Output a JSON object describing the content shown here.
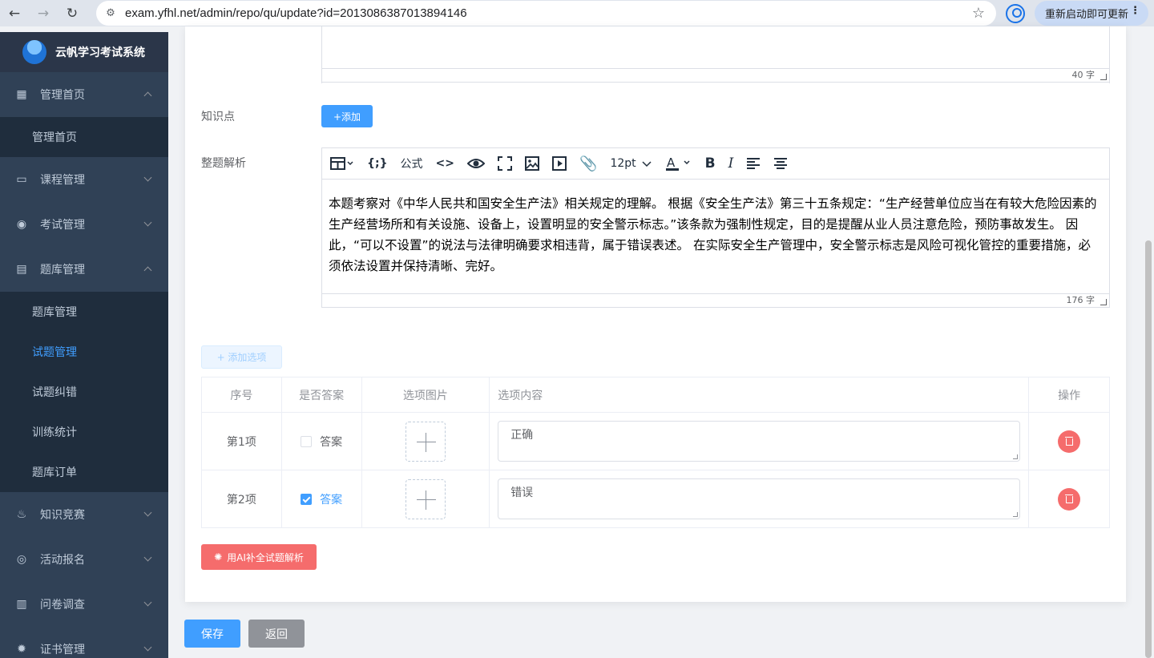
{
  "browser": {
    "url": "exam.yfhl.net/admin/repo/qu/update?id=2013086387013894146",
    "update_label": "重新启动即可更新"
  },
  "sidebar": {
    "logo_title": "云帆学习考试系统",
    "menu": [
      {
        "label": "管理首页",
        "icon": "dashboard-icon",
        "expanded": true,
        "children": [
          "管理首页"
        ]
      },
      {
        "label": "课程管理",
        "icon": "monitor-icon",
        "expanded": false
      },
      {
        "label": "考试管理",
        "icon": "exam-icon",
        "expanded": false
      },
      {
        "label": "题库管理",
        "icon": "document-icon",
        "expanded": true,
        "children": [
          "题库管理",
          "试题管理",
          "试题纠错",
          "训练统计",
          "题库订单"
        ],
        "active_child": "试题管理"
      },
      {
        "label": "知识竞赛",
        "icon": "fire-icon",
        "expanded": false
      },
      {
        "label": "活动报名",
        "icon": "activity-icon",
        "expanded": false
      },
      {
        "label": "问卷调查",
        "icon": "book-icon",
        "expanded": false
      },
      {
        "label": "证书管理",
        "icon": "gear-icon",
        "expanded": false
      }
    ]
  },
  "form": {
    "top_counter": "40 字",
    "knowledge_label": "知识点",
    "add_label": "+添加",
    "analysis_label": "整题解析",
    "toolbar": {
      "formula": "公式",
      "font_size": "12pt"
    },
    "analysis_text": "本题考察对《中华人民共和国安全生产法》相关规定的理解。 根据《安全生产法》第三十五条规定：“生产经营单位应当在有较大危险因素的生产经营场所和有关设施、设备上，设置明显的安全警示标志。”该条款为强制性规定，目的是提醒从业人员注意危险，预防事故发生。 因此，“可以不设置”的说法与法律明确要求相违背，属于错误表述。 在实际安全生产管理中，安全警示标志是风险可视化管控的重要措施，必须依法设置并保持清晰、完好。",
    "analysis_counter": "176 字",
    "add_option_label": "+ 添加选项",
    "table": {
      "headers": [
        "序号",
        "是否答案",
        "选项图片",
        "选项内容",
        "操作"
      ],
      "rows": [
        {
          "index": "第1项",
          "answer_label": "答案",
          "is_answer": false,
          "content": "正确"
        },
        {
          "index": "第2项",
          "answer_label": "答案",
          "is_answer": true,
          "content": "错误"
        }
      ]
    },
    "ai_button": "用AI补全试题解析"
  },
  "footer": {
    "save": "保存",
    "back": "返回"
  },
  "colors": {
    "primary": "#409eff",
    "danger": "#f56c6c",
    "sidebar": "#304156"
  }
}
